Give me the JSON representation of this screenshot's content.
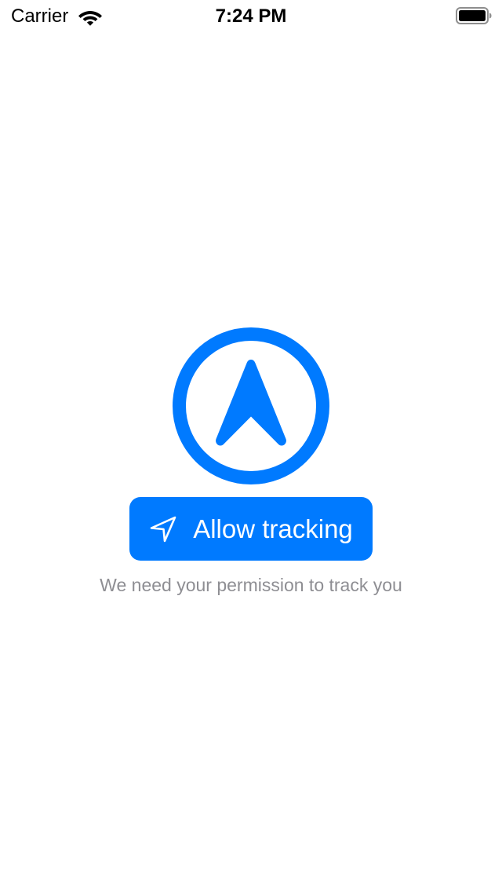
{
  "status_bar": {
    "carrier": "Carrier",
    "time": "7:24 PM",
    "wifi_icon": "wifi-icon",
    "battery_icon": "battery-full-icon"
  },
  "main": {
    "emblem_icon": "location-arrow-circle-icon",
    "allow_button": {
      "label": "Allow tracking",
      "icon": "location-arrow-outline-icon"
    },
    "subtitle": "We need your permission to track you"
  },
  "colors": {
    "accent": "#007aff",
    "button_text": "#ffffff",
    "subtitle_text": "#8e8e93",
    "background": "#ffffff"
  }
}
